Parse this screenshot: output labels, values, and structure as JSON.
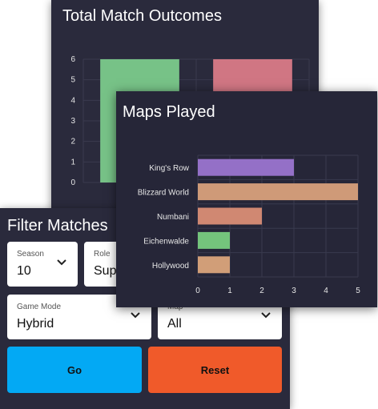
{
  "outcomes_card": {
    "title": "Total Match Outcomes",
    "chart_data": {
      "type": "bar",
      "title": "Total Match Outcomes",
      "categories": [
        "",
        ""
      ],
      "values": [
        6,
        6
      ],
      "colors": [
        "#77c287",
        "#d07683"
      ],
      "ylim": [
        0,
        6
      ],
      "yticks": [
        0,
        1,
        2,
        3,
        4,
        5,
        6
      ],
      "grid": true
    }
  },
  "maps_card": {
    "title": "Maps Played",
    "chart_data": {
      "type": "bar",
      "orientation": "horizontal",
      "title": "Maps Played",
      "categories": [
        "King's Row",
        "Blizzard World",
        "Numbani",
        "Eichenwalde",
        "Hollywood"
      ],
      "values": [
        3,
        5,
        2,
        1,
        1
      ],
      "colors": [
        "#9470c7",
        "#cf9a78",
        "#d08872",
        "#74c47c",
        "#d19e78"
      ],
      "xlim": [
        0,
        5
      ],
      "xticks": [
        0,
        1,
        2,
        3,
        4,
        5
      ],
      "grid": true
    }
  },
  "filter": {
    "title": "Filter Matches",
    "season": {
      "label": "Season",
      "value": "10"
    },
    "role": {
      "label": "Role",
      "value": "Sup"
    },
    "game_mode": {
      "label": "Game Mode",
      "value": "Hybrid"
    },
    "map": {
      "label": "Map",
      "value": "All"
    },
    "go_label": "Go",
    "reset_label": "Reset"
  }
}
